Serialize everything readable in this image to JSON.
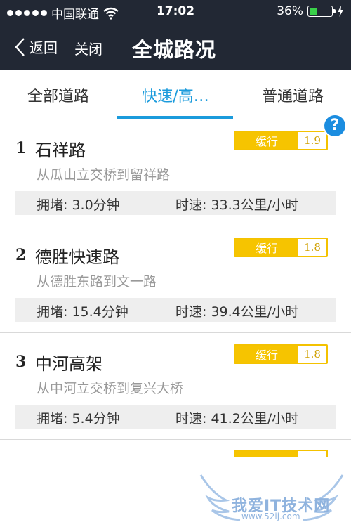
{
  "status_bar": {
    "carrier": "中国联通",
    "time": "17:02",
    "battery_percent": "36%",
    "battery_level": 0.36,
    "battery_color": "#3ad14a"
  },
  "nav": {
    "back_label": "返回",
    "close_label": "关闭",
    "title": "全城路况"
  },
  "tabs": [
    {
      "label": "全部道路",
      "active": false
    },
    {
      "label": "快速/高…",
      "active": true
    },
    {
      "label": "普通道路",
      "active": false
    }
  ],
  "help_label": "?",
  "roads": [
    {
      "rank": "1",
      "name": "石祥路",
      "desc": "从瓜山立交桥到留祥路",
      "status": "缓行",
      "index": "1.9",
      "jam": "拥堵: 3.0分钟",
      "speed": "时速: 33.3公里/小时"
    },
    {
      "rank": "2",
      "name": "德胜快速路",
      "desc": "从德胜东路到文一路",
      "status": "缓行",
      "index": "1.8",
      "jam": "拥堵: 15.4分钟",
      "speed": "时速: 39.4公里/小时"
    },
    {
      "rank": "3",
      "name": "中河高架",
      "desc": "从中河立交桥到复兴大桥",
      "status": "缓行",
      "index": "1.8",
      "jam": "拥堵: 5.4分钟",
      "speed": "时速: 41.2公里/小时"
    }
  ],
  "colors": {
    "topbar": "#222834",
    "accent": "#1b9bdc",
    "badge": "#f6c400"
  },
  "watermark": {
    "text": "我爱IT技术网",
    "url": "www.52ij.com"
  }
}
